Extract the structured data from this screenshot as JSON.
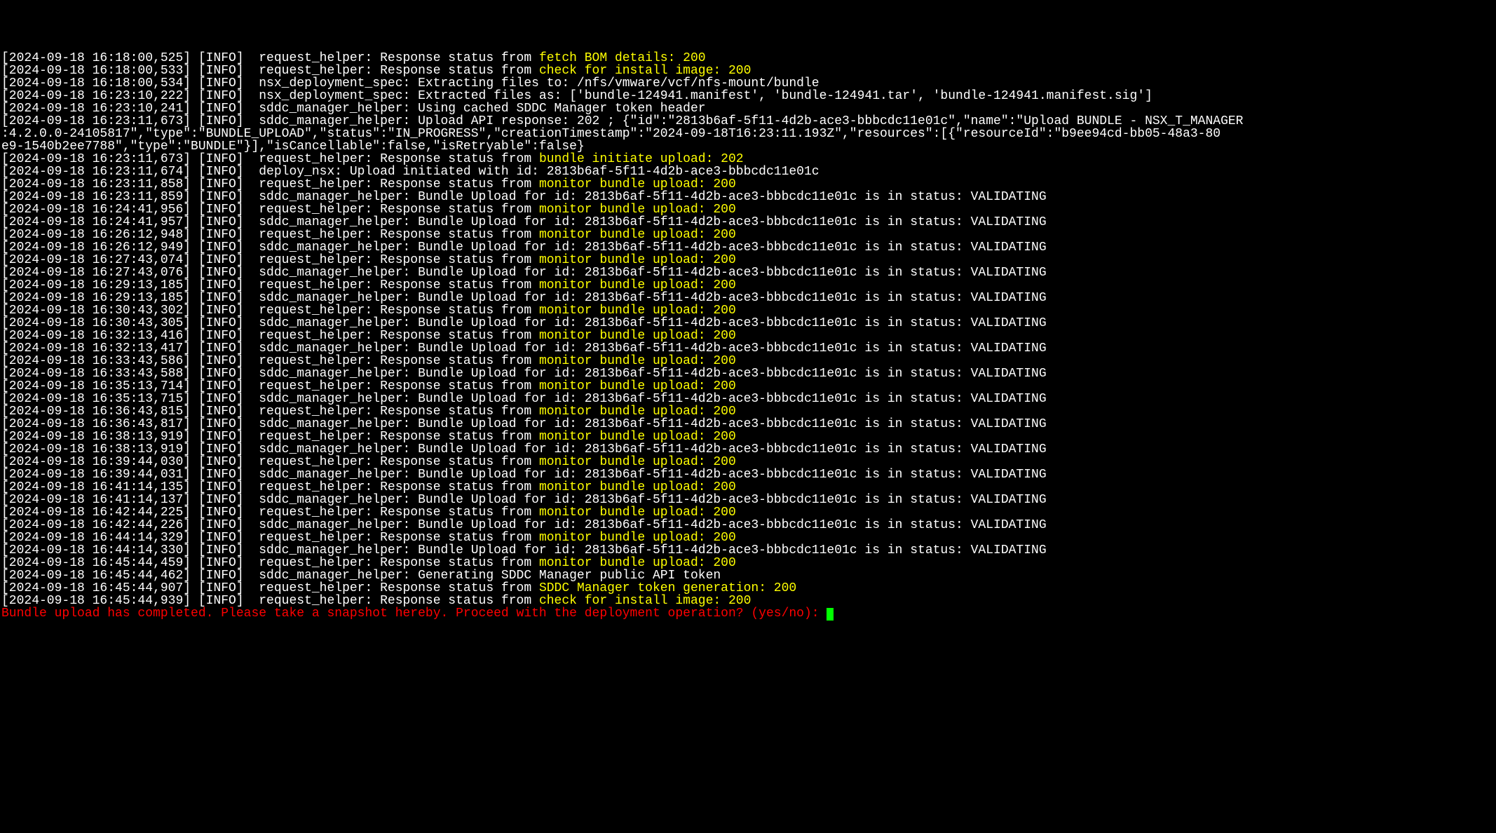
{
  "lines": [
    {
      "type": "fetch_bom",
      "ts": "2024-09-18 16:18:00,525",
      "level": "INFO",
      "module": "request_helper",
      "prefix": "Response status from ",
      "action": "fetch BOM details: 200"
    },
    {
      "type": "check_install",
      "ts": "2024-09-18 16:18:00,533",
      "level": "INFO",
      "module": "request_helper",
      "prefix": "Response status from ",
      "action": "check for install image: 200"
    },
    {
      "type": "plain",
      "ts": "2024-09-18 16:18:00,534",
      "level": "INFO",
      "module": "nsx_deployment_spec",
      "msg": "Extracting files to: /nfs/vmware/vcf/nfs-mount/bundle"
    },
    {
      "type": "plain",
      "ts": "2024-09-18 16:23:10,222",
      "level": "INFO",
      "module": "nsx_deployment_spec",
      "msg": "Extracted files as: ['bundle-124941.manifest', 'bundle-124941.tar', 'bundle-124941.manifest.sig']"
    },
    {
      "type": "plain",
      "ts": "2024-09-18 16:23:10,241",
      "level": "INFO",
      "module": "sddc_manager_helper",
      "msg": "Using cached SDDC Manager token header"
    },
    {
      "type": "upload_api",
      "ts": "2024-09-18 16:23:11,673",
      "level": "INFO",
      "module": "sddc_manager_helper",
      "msg1": "Upload API response: 202 ; {\"id\":\"2813b6af-5f11-4d2b-ace3-bbbcdc11e01c\",\"name\":\"Upload BUNDLE - NSX_T_MANAGER",
      "msg2": ":4.2.0.0-24105817\",\"type\":\"BUNDLE_UPLOAD\",\"status\":\"IN_PROGRESS\",\"creationTimestamp\":\"2024-09-18T16:23:11.193Z\",\"resources\":[{\"resourceId\":\"b9ee94cd-bb05-48a3-80",
      "msg3": "e9-1540b2ee7788\",\"type\":\"BUNDLE\"}],\"isCancellable\":false,\"isRetryable\":false}"
    },
    {
      "type": "bundle_initiate",
      "ts": "2024-09-18 16:23:11,673",
      "level": "INFO",
      "module": "request_helper",
      "prefix": "Response status from ",
      "action": "bundle initiate upload: 202"
    },
    {
      "type": "plain",
      "ts": "2024-09-18 16:23:11,674",
      "level": "INFO",
      "module": "deploy_nsx",
      "msg": "Upload initiated with id: 2813b6af-5f11-4d2b-ace3-bbbcdc11e01c"
    },
    {
      "type": "monitor",
      "ts": "2024-09-18 16:23:11,858",
      "level": "INFO",
      "module": "request_helper",
      "prefix": "Response status from ",
      "action": "monitor bundle upload: 200"
    },
    {
      "type": "plain",
      "ts": "2024-09-18 16:23:11,859",
      "level": "INFO",
      "module": "sddc_manager_helper",
      "msg": "Bundle Upload for id: 2813b6af-5f11-4d2b-ace3-bbbcdc11e01c is in status: VALIDATING"
    },
    {
      "type": "monitor",
      "ts": "2024-09-18 16:24:41,956",
      "level": "INFO",
      "module": "request_helper",
      "prefix": "Response status from ",
      "action": "monitor bundle upload: 200"
    },
    {
      "type": "plain",
      "ts": "2024-09-18 16:24:41,957",
      "level": "INFO",
      "module": "sddc_manager_helper",
      "msg": "Bundle Upload for id: 2813b6af-5f11-4d2b-ace3-bbbcdc11e01c is in status: VALIDATING"
    },
    {
      "type": "monitor",
      "ts": "2024-09-18 16:26:12,948",
      "level": "INFO",
      "module": "request_helper",
      "prefix": "Response status from ",
      "action": "monitor bundle upload: 200"
    },
    {
      "type": "plain",
      "ts": "2024-09-18 16:26:12,949",
      "level": "INFO",
      "module": "sddc_manager_helper",
      "msg": "Bundle Upload for id: 2813b6af-5f11-4d2b-ace3-bbbcdc11e01c is in status: VALIDATING"
    },
    {
      "type": "monitor",
      "ts": "2024-09-18 16:27:43,074",
      "level": "INFO",
      "module": "request_helper",
      "prefix": "Response status from ",
      "action": "monitor bundle upload: 200"
    },
    {
      "type": "plain",
      "ts": "2024-09-18 16:27:43,076",
      "level": "INFO",
      "module": "sddc_manager_helper",
      "msg": "Bundle Upload for id: 2813b6af-5f11-4d2b-ace3-bbbcdc11e01c is in status: VALIDATING"
    },
    {
      "type": "monitor",
      "ts": "2024-09-18 16:29:13,185",
      "level": "INFO",
      "module": "request_helper",
      "prefix": "Response status from ",
      "action": "monitor bundle upload: 200"
    },
    {
      "type": "plain",
      "ts": "2024-09-18 16:29:13,185",
      "level": "INFO",
      "module": "sddc_manager_helper",
      "msg": "Bundle Upload for id: 2813b6af-5f11-4d2b-ace3-bbbcdc11e01c is in status: VALIDATING"
    },
    {
      "type": "monitor",
      "ts": "2024-09-18 16:30:43,302",
      "level": "INFO",
      "module": "request_helper",
      "prefix": "Response status from ",
      "action": "monitor bundle upload: 200"
    },
    {
      "type": "plain",
      "ts": "2024-09-18 16:30:43,305",
      "level": "INFO",
      "module": "sddc_manager_helper",
      "msg": "Bundle Upload for id: 2813b6af-5f11-4d2b-ace3-bbbcdc11e01c is in status: VALIDATING"
    },
    {
      "type": "monitor",
      "ts": "2024-09-18 16:32:13,416",
      "level": "INFO",
      "module": "request_helper",
      "prefix": "Response status from ",
      "action": "monitor bundle upload: 200"
    },
    {
      "type": "plain",
      "ts": "2024-09-18 16:32:13,417",
      "level": "INFO",
      "module": "sddc_manager_helper",
      "msg": "Bundle Upload for id: 2813b6af-5f11-4d2b-ace3-bbbcdc11e01c is in status: VALIDATING"
    },
    {
      "type": "monitor",
      "ts": "2024-09-18 16:33:43,586",
      "level": "INFO",
      "module": "request_helper",
      "prefix": "Response status from ",
      "action": "monitor bundle upload: 200"
    },
    {
      "type": "plain",
      "ts": "2024-09-18 16:33:43,588",
      "level": "INFO",
      "module": "sddc_manager_helper",
      "msg": "Bundle Upload for id: 2813b6af-5f11-4d2b-ace3-bbbcdc11e01c is in status: VALIDATING"
    },
    {
      "type": "monitor",
      "ts": "2024-09-18 16:35:13,714",
      "level": "INFO",
      "module": "request_helper",
      "prefix": "Response status from ",
      "action": "monitor bundle upload: 200"
    },
    {
      "type": "plain",
      "ts": "2024-09-18 16:35:13,715",
      "level": "INFO",
      "module": "sddc_manager_helper",
      "msg": "Bundle Upload for id: 2813b6af-5f11-4d2b-ace3-bbbcdc11e01c is in status: VALIDATING"
    },
    {
      "type": "monitor",
      "ts": "2024-09-18 16:36:43,815",
      "level": "INFO",
      "module": "request_helper",
      "prefix": "Response status from ",
      "action": "monitor bundle upload: 200"
    },
    {
      "type": "plain",
      "ts": "2024-09-18 16:36:43,817",
      "level": "INFO",
      "module": "sddc_manager_helper",
      "msg": "Bundle Upload for id: 2813b6af-5f11-4d2b-ace3-bbbcdc11e01c is in status: VALIDATING"
    },
    {
      "type": "monitor",
      "ts": "2024-09-18 16:38:13,919",
      "level": "INFO",
      "module": "request_helper",
      "prefix": "Response status from ",
      "action": "monitor bundle upload: 200"
    },
    {
      "type": "plain",
      "ts": "2024-09-18 16:38:13,919",
      "level": "INFO",
      "module": "sddc_manager_helper",
      "msg": "Bundle Upload for id: 2813b6af-5f11-4d2b-ace3-bbbcdc11e01c is in status: VALIDATING"
    },
    {
      "type": "monitor",
      "ts": "2024-09-18 16:39:44,030",
      "level": "INFO",
      "module": "request_helper",
      "prefix": "Response status from ",
      "action": "monitor bundle upload: 200"
    },
    {
      "type": "plain",
      "ts": "2024-09-18 16:39:44,031",
      "level": "INFO",
      "module": "sddc_manager_helper",
      "msg": "Bundle Upload for id: 2813b6af-5f11-4d2b-ace3-bbbcdc11e01c is in status: VALIDATING"
    },
    {
      "type": "monitor",
      "ts": "2024-09-18 16:41:14,135",
      "level": "INFO",
      "module": "request_helper",
      "prefix": "Response status from ",
      "action": "monitor bundle upload: 200"
    },
    {
      "type": "plain",
      "ts": "2024-09-18 16:41:14,137",
      "level": "INFO",
      "module": "sddc_manager_helper",
      "msg": "Bundle Upload for id: 2813b6af-5f11-4d2b-ace3-bbbcdc11e01c is in status: VALIDATING"
    },
    {
      "type": "monitor",
      "ts": "2024-09-18 16:42:44,225",
      "level": "INFO",
      "module": "request_helper",
      "prefix": "Response status from ",
      "action": "monitor bundle upload: 200"
    },
    {
      "type": "plain",
      "ts": "2024-09-18 16:42:44,226",
      "level": "INFO",
      "module": "sddc_manager_helper",
      "msg": "Bundle Upload for id: 2813b6af-5f11-4d2b-ace3-bbbcdc11e01c is in status: VALIDATING"
    },
    {
      "type": "monitor",
      "ts": "2024-09-18 16:44:14,329",
      "level": "INFO",
      "module": "request_helper",
      "prefix": "Response status from ",
      "action": "monitor bundle upload: 200"
    },
    {
      "type": "plain",
      "ts": "2024-09-18 16:44:14,330",
      "level": "INFO",
      "module": "sddc_manager_helper",
      "msg": "Bundle Upload for id: 2813b6af-5f11-4d2b-ace3-bbbcdc11e01c is in status: VALIDATING"
    },
    {
      "type": "monitor",
      "ts": "2024-09-18 16:45:44,459",
      "level": "INFO",
      "module": "request_helper",
      "prefix": "Response status from ",
      "action": "monitor bundle upload: 200"
    },
    {
      "type": "plain",
      "ts": "2024-09-18 16:45:44,462",
      "level": "INFO",
      "module": "sddc_manager_helper",
      "msg": "Generating SDDC Manager public API token"
    },
    {
      "type": "token_gen",
      "ts": "2024-09-18 16:45:44,907",
      "level": "INFO",
      "module": "request_helper",
      "prefix": "Response status from ",
      "action": "SDDC Manager token generation: 200"
    },
    {
      "type": "check_install",
      "ts": "2024-09-18 16:45:44,939",
      "level": "INFO",
      "module": "request_helper",
      "prefix": "Response status from ",
      "action": "check for install image: 200"
    }
  ],
  "prompt": "Bundle upload has completed. Please take a snapshot hereby. Proceed with the deployment operation? (yes/no): "
}
